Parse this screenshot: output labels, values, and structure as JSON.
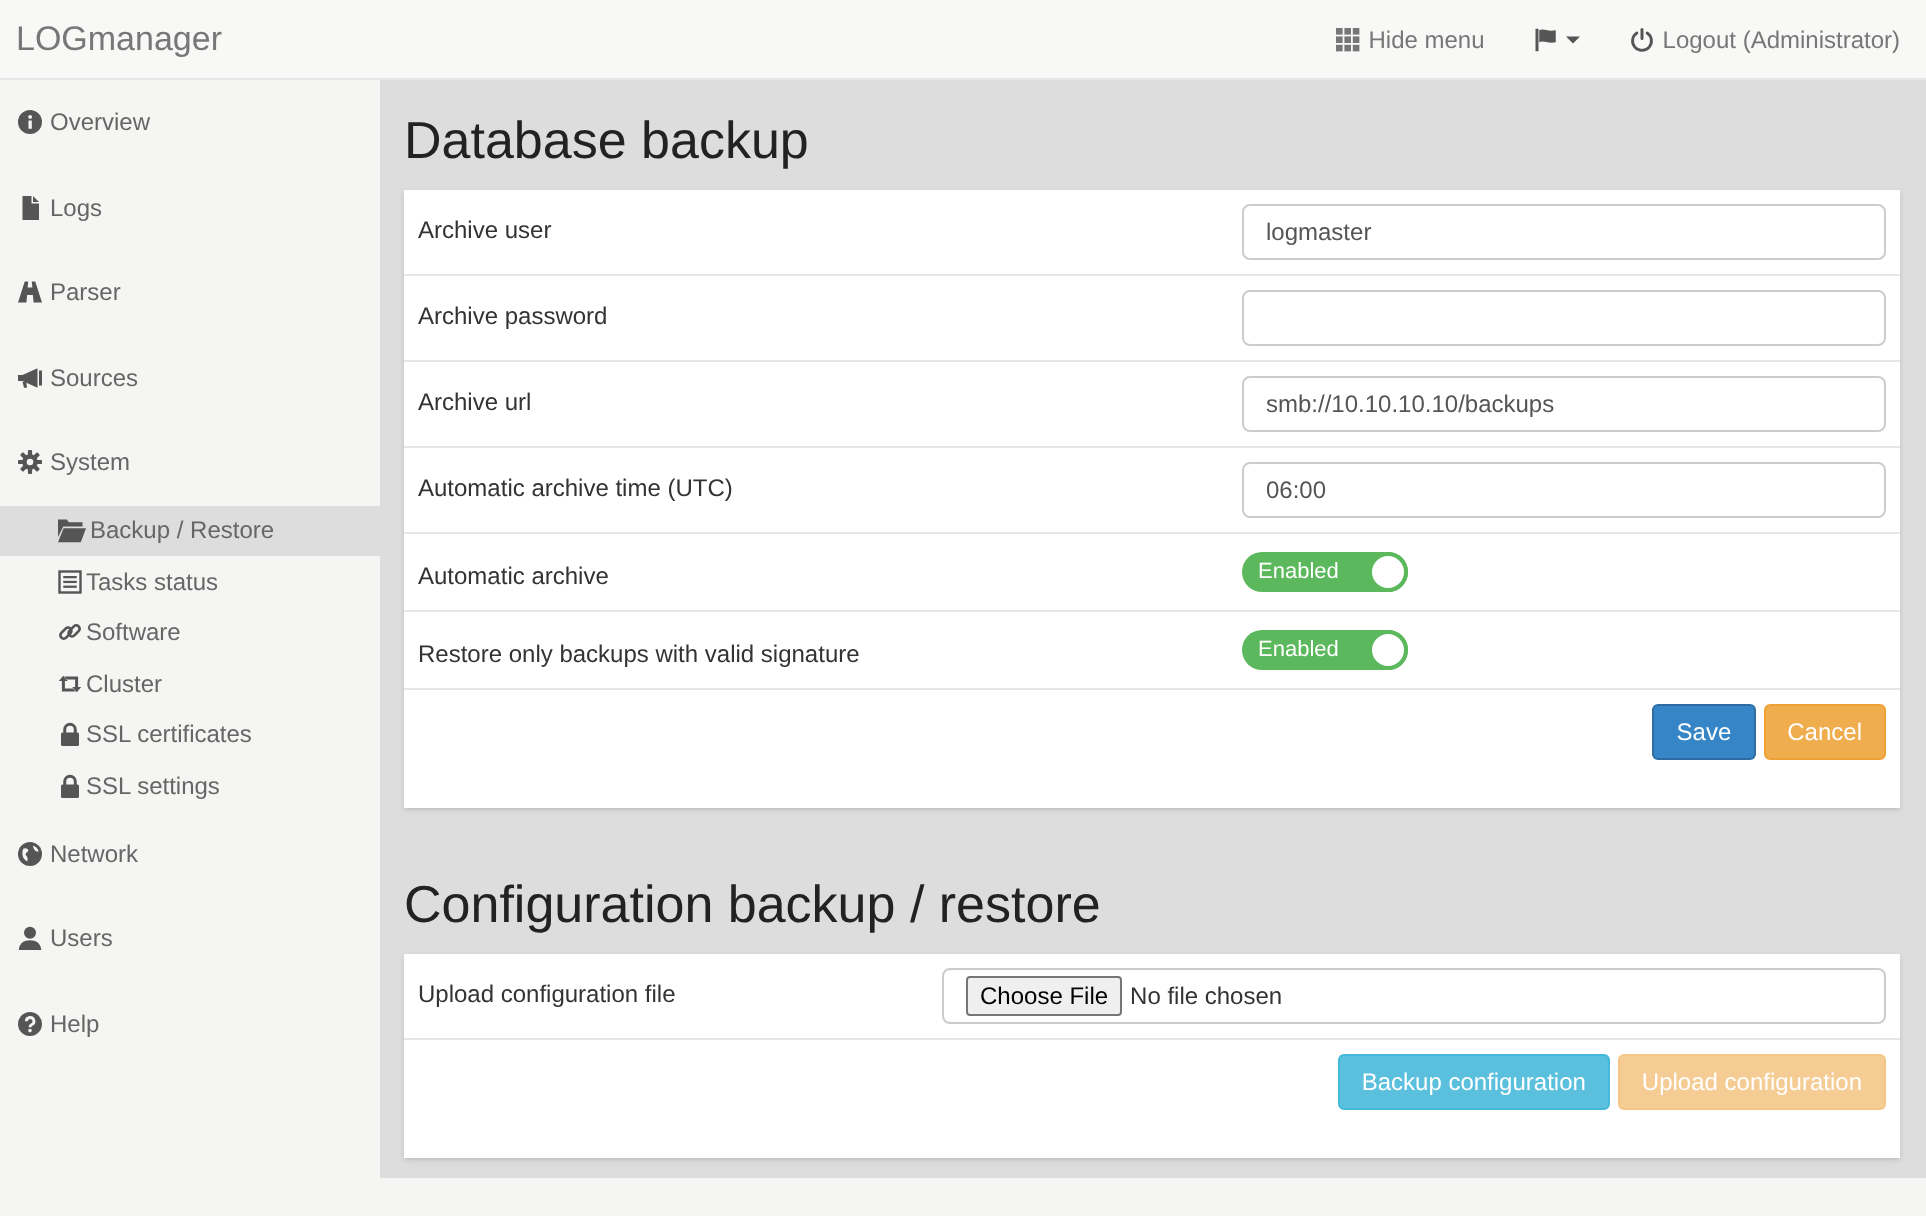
{
  "header": {
    "brand": "LOGmanager",
    "hide_menu": "Hide menu",
    "logout": "Logout (Administrator)"
  },
  "sidebar": {
    "items": [
      {
        "label": "Overview",
        "selected": false
      },
      {
        "label": "Logs",
        "selected": false
      },
      {
        "label": "Parser",
        "selected": false
      },
      {
        "label": "Sources",
        "selected": false
      },
      {
        "label": "System",
        "selected": false,
        "children": [
          {
            "label": "Backup / Restore",
            "selected": true
          },
          {
            "label": "Tasks status",
            "selected": false
          },
          {
            "label": "Software",
            "selected": false
          },
          {
            "label": "Cluster",
            "selected": false
          },
          {
            "label": "SSL certificates",
            "selected": false
          },
          {
            "label": "SSL settings",
            "selected": false
          }
        ]
      },
      {
        "label": "Network",
        "selected": false
      },
      {
        "label": "Users",
        "selected": false
      },
      {
        "label": "Help",
        "selected": false
      }
    ]
  },
  "sections": [
    {
      "title": "Database backup",
      "rows": [
        {
          "kind": "text",
          "label": "Archive user",
          "value": "logmaster"
        },
        {
          "kind": "password",
          "label": "Archive password"
        },
        {
          "kind": "text",
          "label": "Archive url",
          "value": "smb://10.10.10.10/backups"
        },
        {
          "kind": "text",
          "label": "Automatic archive time (UTC)",
          "value": "06:00"
        },
        {
          "kind": "toggle",
          "label": "Automatic archive",
          "on": true,
          "text": "Enabled"
        },
        {
          "kind": "toggle",
          "label": "Restore only backups with valid signature",
          "on": true,
          "text": "Enabled"
        }
      ],
      "buttons": [
        {
          "kind": "primary",
          "label": "Save",
          "disabled": false
        },
        {
          "kind": "warning",
          "label": "Cancel",
          "disabled": false
        }
      ]
    },
    {
      "title": "Configuration backup / restore",
      "rows": [
        {
          "kind": "file",
          "label": "Upload configuration file",
          "button": "Choose File",
          "status": "No file chosen"
        }
      ],
      "buttons": [
        {
          "kind": "info",
          "label": "Backup configuration",
          "disabled": false
        },
        {
          "kind": "warning",
          "label": "Upload configuration",
          "disabled": true
        }
      ]
    }
  ]
}
